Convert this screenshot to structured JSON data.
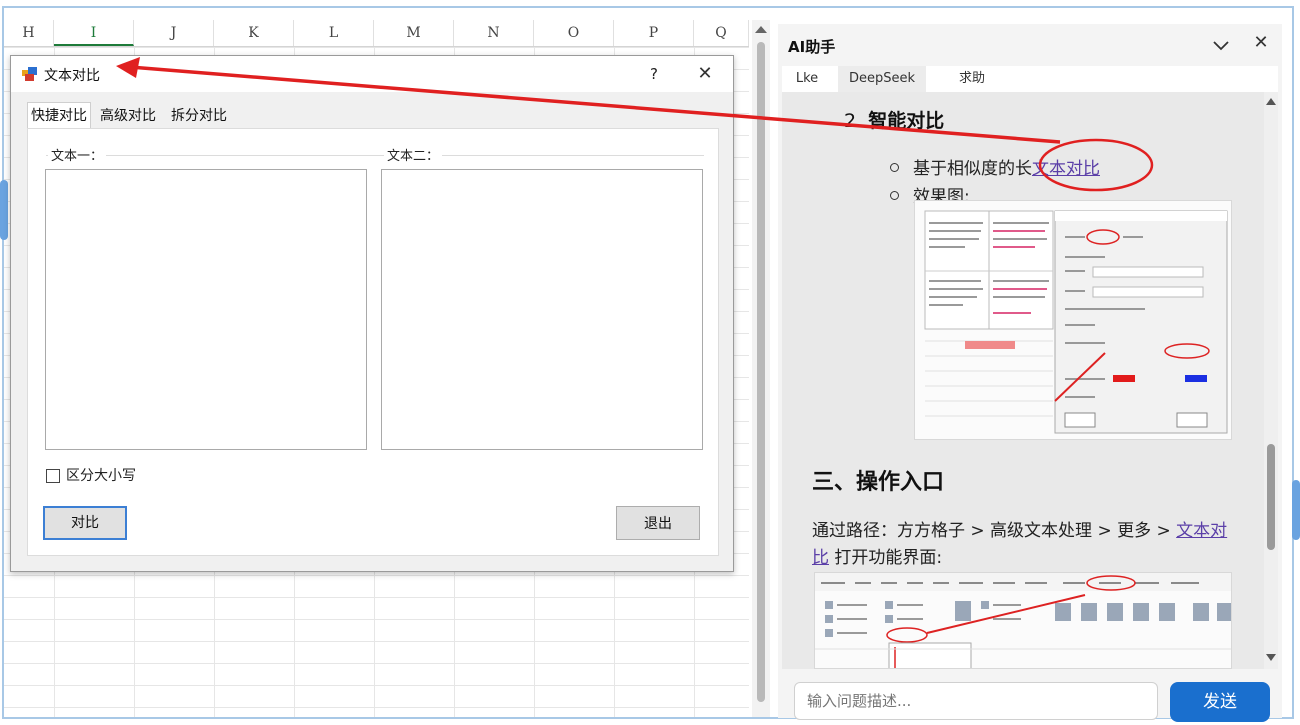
{
  "sheet": {
    "columns": [
      "H",
      "I",
      "J",
      "K",
      "L",
      "M",
      "N",
      "O",
      "P",
      "Q"
    ],
    "selected_column": "I"
  },
  "dialog": {
    "title": "文本对比",
    "help_label": "?",
    "close_label": "✕",
    "tabs": [
      "快捷对比",
      "高级对比",
      "拆分对比"
    ],
    "active_tab": "快捷对比",
    "text1_label": "文本一：",
    "text2_label": "文本二：",
    "case_sensitive_label": "区分大小写",
    "case_sensitive_checked": false,
    "compare_button": "对比",
    "exit_button": "退出"
  },
  "ai_panel": {
    "title": "AI助手",
    "close_label": "✕",
    "tabs": [
      "Lke",
      "DeepSeek",
      "求助"
    ],
    "active_tab": "DeepSeek",
    "content": {
      "heading_number": "2.",
      "heading_text": "智能对比",
      "bullet1_prefix": "基于相似度的长",
      "bullet1_link": "文本对比",
      "bullet2": "效果图:",
      "section_title": "三、操作入口",
      "path_prefix": "通过路径：方方格子 > 高级文本处理 > 更多 > ",
      "path_link": "文本对比",
      "path_suffix": " 打开功能界面:"
    },
    "input_placeholder": "输入问题描述...",
    "send_label": "发送"
  },
  "colors": {
    "annotation_red": "#e02020",
    "send_blue": "#1a6fce",
    "link_purple": "#5b3fa8",
    "selected_col_green": "#1e7b3a"
  }
}
